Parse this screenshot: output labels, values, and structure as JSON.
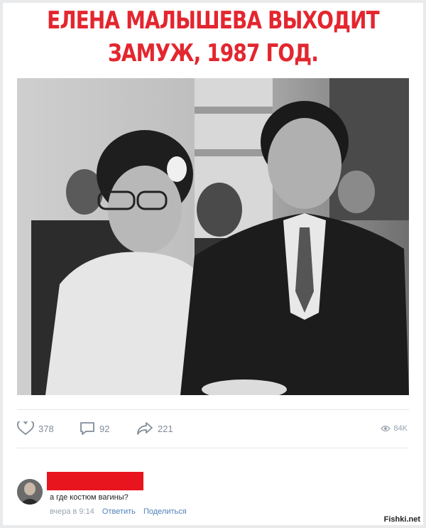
{
  "post": {
    "headline": "ЕЛЕНА МАЛЫШЕВА ВЫХОДИТ ЗАМУЖ, 1987 ГОД.",
    "image_alt": "black and white wedding photo"
  },
  "stats": {
    "likes": "378",
    "comments": "92",
    "shares": "221",
    "views": "84K"
  },
  "comment": {
    "text": "а где костюм вагины?",
    "time": "вчера в 9:14",
    "reply": "Ответить",
    "share": "Поделиться"
  },
  "watermark": "Fishki.net",
  "colors": {
    "headline": "#e3262f",
    "redaction": "#e8141e",
    "link": "#5181b8",
    "muted": "#818c99"
  },
  "icons": [
    "heart-icon",
    "comment-icon",
    "share-icon",
    "eye-icon"
  ]
}
